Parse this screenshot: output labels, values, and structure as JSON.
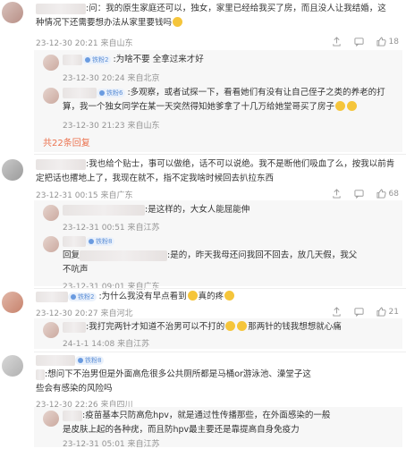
{
  "comments": [
    {
      "text_l1": ":问：我的原生家庭还可以，独女，家里已经给我买了房，而且没人让我结婚，这",
      "text_l2": "种情况下还需要想办法从家里要钱吗",
      "time": "23-12-30 20:21",
      "location": "来自山东",
      "likes": "18"
    },
    {
      "badge": "铁粉2",
      "text": ":为啥不要 全拿过来才好",
      "time": "23-12-30 20:24",
      "location": "来自北京"
    },
    {
      "badge": "铁粉6",
      "text_l1": ":多观察，或者试探一下，看看她们有没有让自己侄子之类的养老的打",
      "text_l2": "算，我一个独女同学在某一天突然得知她爹拿了十几万给她堂哥买了房子",
      "time": "23-12-30 21:23",
      "location": "来自山东"
    },
    {
      "more": "共22条回复"
    },
    {
      "text_l1": ":我也给个贴士，事可以做绝，话不可以说绝。我不是断他们吸血了么，按我以前肯",
      "text_l2": "定把话也撂地上了，我现在就不，指不定我啥时候回去扒拉东西",
      "time": "23-12-31 00:15",
      "location": "来自广东",
      "likes": "68"
    },
    {
      "text": ":是这样的，大女人能屈能伸",
      "time": "23-12-31 00:51",
      "location": "来自江苏"
    },
    {
      "badge": "铁粉8",
      "reply_prefix": "回复",
      "text_l1": ":是的，昨天我母还问我回不回去，放几天假，我父",
      "text_l2": "不吭声",
      "time": "23-12-31 09:01",
      "location": "来自广东"
    },
    {
      "badge": "铁粉2",
      "text": ":为什么我没有早点看到",
      "text_tail": "真的疼",
      "time": "23-12-30 20:27",
      "location": "来自河北",
      "likes": "21"
    },
    {
      "text": ":我打完两针才知道不治男可以不打的",
      "text_tail": "那两针的钱我想想就心痛",
      "time": "24-1-1 14:08",
      "location": "来自江苏"
    },
    {
      "badge": "铁粉8",
      "text_l1": ":想问下不治男但是外面高危很多公共厕所都是马桶or游泳池、澡堂子这",
      "text_l2": "些会有感染的风险吗",
      "time": "23-12-30 22:26",
      "location": "来自四川"
    },
    {
      "text_l1": ":疫苗基本只防高危hpv，就是通过性传播那些，在外面感染的一般",
      "text_l2": "是皮肤上起的各种疣，而且防hpv最主要还是靠提高自身免疫力",
      "time": "23-12-31 05:01",
      "location": "来自江苏"
    }
  ],
  "colors": {
    "accent": "#eb7350",
    "meta": "#939393",
    "badge": "#5b8ed6"
  }
}
